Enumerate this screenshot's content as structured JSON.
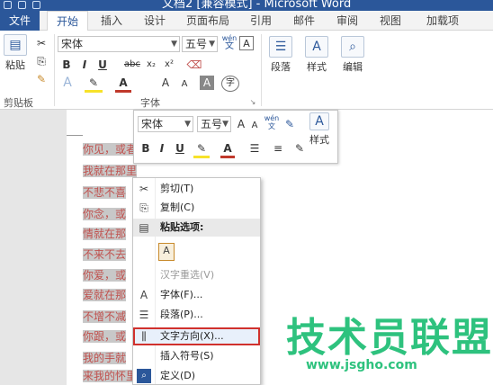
{
  "titlebar": {
    "title": "文档2 [兼容模式] - Microsoft Word"
  },
  "tabs": [
    "文件",
    "开始",
    "插入",
    "设计",
    "页面布局",
    "引用",
    "邮件",
    "审阅",
    "视图",
    "加载项"
  ],
  "ribbon": {
    "paste_label": "粘贴",
    "font_name": "宋体",
    "font_size": "五号",
    "wen_label": "wén",
    "wen_char": "文",
    "bold": "B",
    "italic": "I",
    "underline": "U",
    "strike": "abc",
    "sub": "x₂",
    "sup": "x²",
    "grow": "A",
    "shrink": "A",
    "clipboard_group": "剪贴板",
    "font_group": "字体",
    "paragraph_label": "段落",
    "styles_label": "样式",
    "editing_label": "编辑"
  },
  "mini_toolbar": {
    "font_name": "宋体",
    "font_size": "五号",
    "bold": "B",
    "italic": "I",
    "underline": "U",
    "styles_label": "样式"
  },
  "doc_lines": [
    "你见，或者",
    "我就在那里",
    "不悲不喜",
    "你念，或",
    "情就在那",
    "不来不去",
    "你爱，或",
    "爱就在那",
    "不增不减",
    "你跟，或",
    "我的手就",
    "来我的怀里"
  ],
  "context_menu": [
    {
      "icon": "scissors-icon",
      "glyph": "✂",
      "label": "剪切(T)",
      "state": "normal"
    },
    {
      "icon": "copy-icon",
      "glyph": "⎘",
      "label": "复制(C)",
      "state": "normal"
    },
    {
      "icon": "paste-icon",
      "glyph": "📋",
      "label": "粘贴选项:",
      "state": "header"
    },
    {
      "icon": "",
      "glyph": "",
      "label": "",
      "state": "paste-option"
    },
    {
      "icon": "",
      "glyph": "",
      "label": "汉字重选(V)",
      "state": "disabled"
    },
    {
      "icon": "font-icon",
      "glyph": "A",
      "label": "字体(F)...",
      "state": "normal"
    },
    {
      "icon": "paragraph-icon",
      "glyph": "☰",
      "label": "段落(P)...",
      "state": "normal"
    },
    {
      "icon": "text-direction-icon",
      "glyph": "⫼",
      "label": "文字方向(X)...",
      "state": "selected"
    },
    {
      "icon": "",
      "glyph": "",
      "label": "插入符号(S)",
      "state": "normal"
    },
    {
      "icon": "define-icon",
      "glyph": "🔍",
      "label": "定义(D)",
      "state": "normal"
    }
  ],
  "watermark": {
    "title": "技术员联盟",
    "url": "www.jsgho.com"
  },
  "colors": {
    "accent": "#2b579a",
    "doc_text": "#c0504d",
    "highlight": "#d0312d",
    "watermark": "#2ec27e"
  }
}
